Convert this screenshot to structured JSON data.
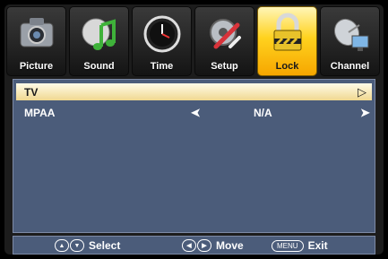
{
  "tabs": [
    {
      "label": "Picture",
      "icon": "camera-icon"
    },
    {
      "label": "Sound",
      "icon": "music-note-icon"
    },
    {
      "label": "Time",
      "icon": "clock-icon"
    },
    {
      "label": "Setup",
      "icon": "wrench-icon"
    },
    {
      "label": "Lock",
      "icon": "padlock-icon",
      "active": true
    },
    {
      "label": "Channel",
      "icon": "satellite-dish-icon"
    }
  ],
  "menu": {
    "rows": [
      {
        "label": "TV",
        "value": "",
        "arrow_right": "▷",
        "selected": true
      },
      {
        "label": "MPAA",
        "value": "N/A",
        "arrow_left": "➤",
        "arrow_right": "➤"
      }
    ]
  },
  "footer": {
    "select_label": "Select",
    "move_label": "Move",
    "menu_key": "MENU",
    "exit_label": "Exit"
  },
  "colors": {
    "panel": "#4b5c7a",
    "active_tab": "#ffd21e",
    "selected_row": "#f0d890"
  }
}
